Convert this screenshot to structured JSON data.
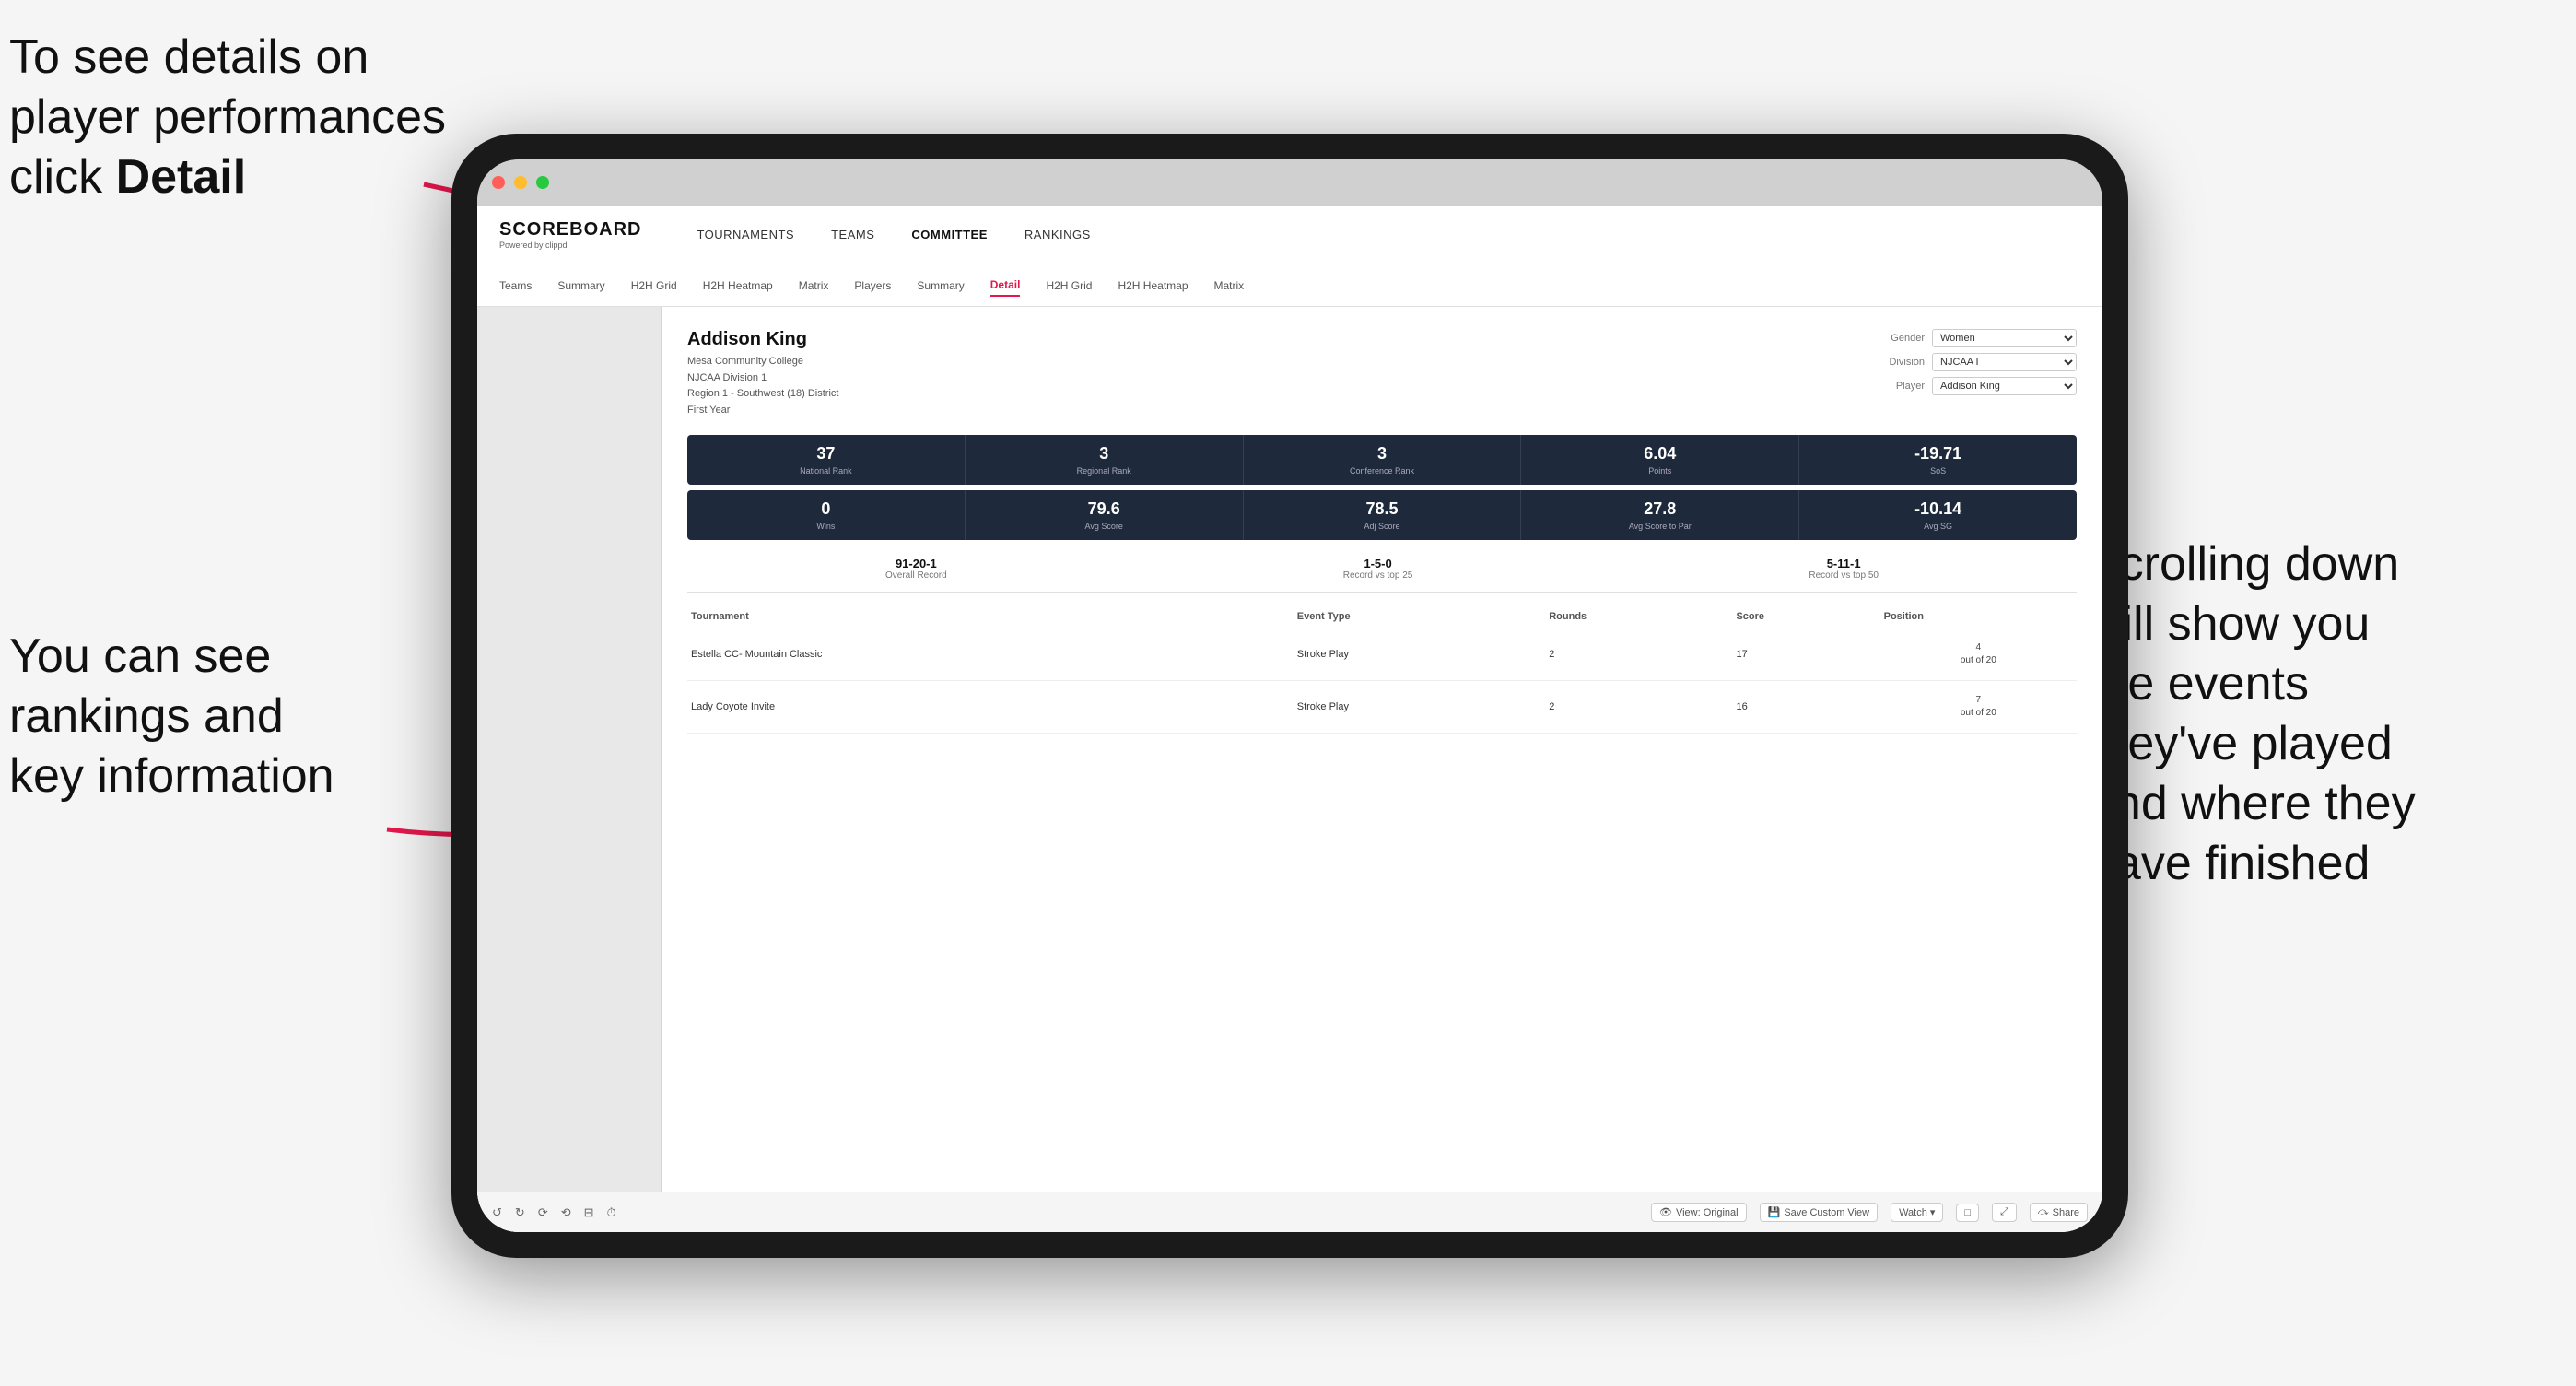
{
  "annotations": {
    "top_left": {
      "line1": "To see details on",
      "line2": "player performances",
      "line3": "click ",
      "line3_bold": "Detail"
    },
    "bottom_left": {
      "line1": "You can see",
      "line2": "rankings and",
      "line3": "key information"
    },
    "right": {
      "line1": "Scrolling down",
      "line2": "will show you",
      "line3": "the events",
      "line4": "they've played",
      "line5": "and where they",
      "line6": "have finished"
    }
  },
  "nav": {
    "logo": "SCOREBOARD",
    "logo_sub": "Powered by clippd",
    "items": [
      "TOURNAMENTS",
      "TEAMS",
      "COMMITTEE",
      "RANKINGS"
    ]
  },
  "sub_nav": {
    "items": [
      "Teams",
      "Summary",
      "H2H Grid",
      "H2H Heatmap",
      "Matrix",
      "Players",
      "Summary",
      "Detail",
      "H2H Grid",
      "H2H Heatmap",
      "Matrix"
    ]
  },
  "player": {
    "name": "Addison King",
    "college": "Mesa Community College",
    "division": "NJCAA Division 1",
    "region": "Region 1 - Southwest (18) District",
    "year": "First Year"
  },
  "controls": {
    "gender_label": "Gender",
    "gender_value": "Women",
    "division_label": "Division",
    "division_value": "NJCAA I",
    "player_label": "Player",
    "player_value": "Addison King"
  },
  "stats_row1": [
    {
      "value": "37",
      "label": "National Rank"
    },
    {
      "value": "3",
      "label": "Regional Rank"
    },
    {
      "value": "3",
      "label": "Conference Rank"
    },
    {
      "value": "6.04",
      "label": "Points"
    },
    {
      "value": "-19.71",
      "label": "SoS"
    }
  ],
  "stats_row2": [
    {
      "value": "0",
      "label": "Wins"
    },
    {
      "value": "79.6",
      "label": "Avg Score"
    },
    {
      "value": "78.5",
      "label": "Adj Score"
    },
    {
      "value": "27.8",
      "label": "Avg Score to Par"
    },
    {
      "value": "-10.14",
      "label": "Avg SG"
    }
  ],
  "records": [
    {
      "value": "91-20-1",
      "label": "Overall Record"
    },
    {
      "value": "1-5-0",
      "label": "Record vs top 25"
    },
    {
      "value": "5-11-1",
      "label": "Record vs top 50"
    }
  ],
  "table": {
    "headers": [
      "Tournament",
      "",
      "Event Type",
      "Rounds",
      "Score",
      "Position"
    ],
    "rows": [
      {
        "tournament": "Estella CC- Mountain Classic",
        "event_type": "Stroke Play",
        "rounds": "2",
        "score": "17",
        "position": "4\nout of 20"
      },
      {
        "tournament": "Lady Coyote Invite",
        "event_type": "Stroke Play",
        "rounds": "2",
        "score": "16",
        "position": "7\nout of 20"
      }
    ]
  },
  "toolbar": {
    "items": [
      "↺",
      "↻",
      "⟳",
      "⟲",
      "□-",
      "⏱",
      "View: Original",
      "Save Custom View",
      "Watch ▾",
      "□▾",
      "⤢",
      "Share"
    ]
  }
}
